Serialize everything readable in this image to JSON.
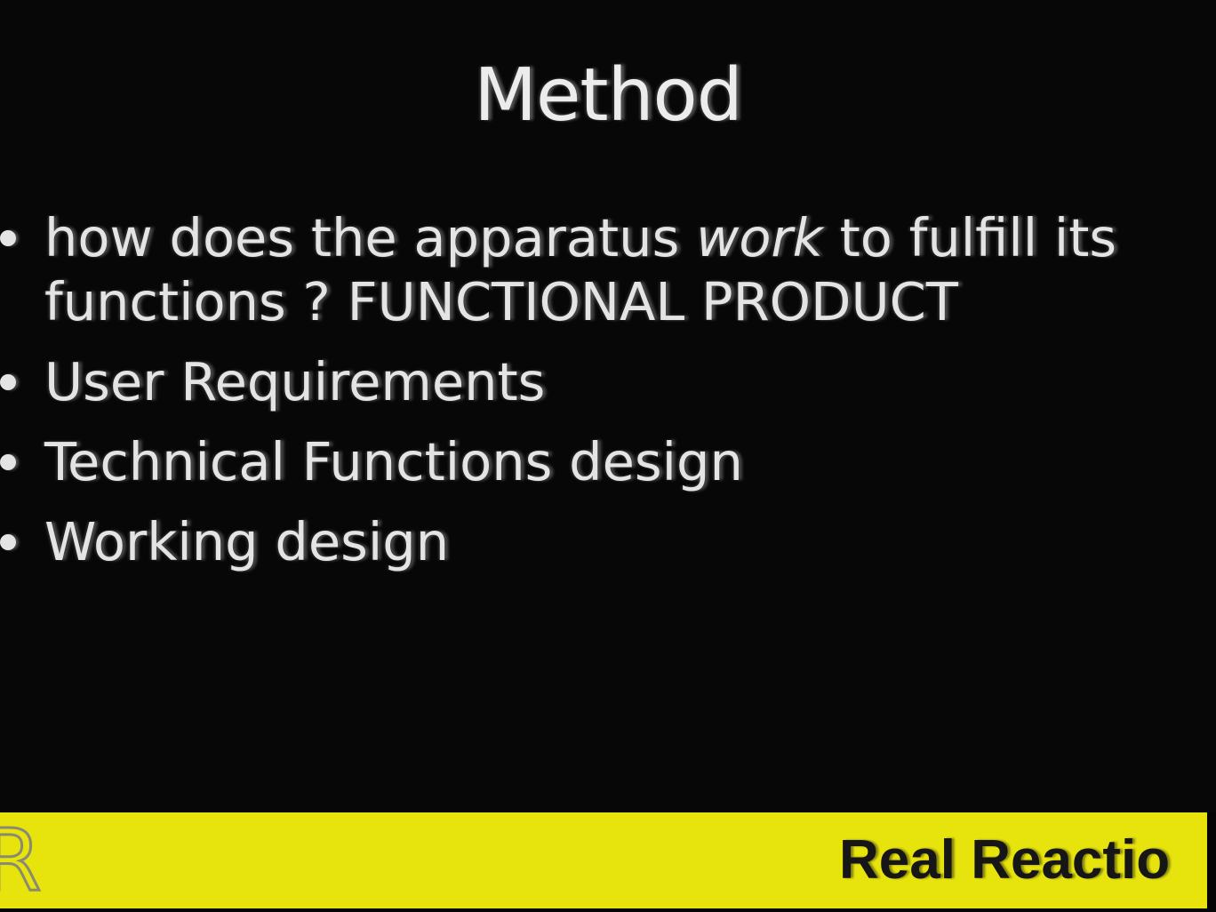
{
  "slide": {
    "title": "Method",
    "bullets": [
      {
        "before": "how does the apparatus ",
        "emphasis": "work",
        "after": " to fulfill its functions ? FUNCTIONAL PRODUCT"
      },
      {
        "text": "User Requirements"
      },
      {
        "text": "Technical Functions design"
      },
      {
        "text": "Working design"
      }
    ]
  },
  "footer": {
    "logo_letter": "R",
    "text": "Real Reactio",
    "background": "#e7e30c"
  },
  "colors": {
    "background": "#070707",
    "text": "#e6e6e6"
  }
}
